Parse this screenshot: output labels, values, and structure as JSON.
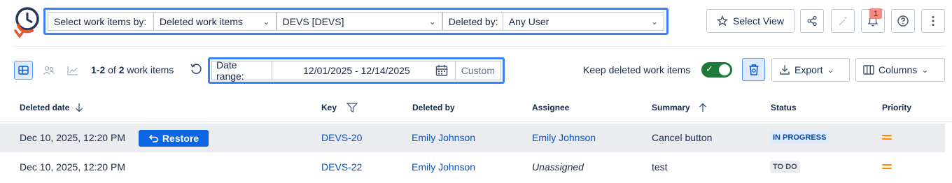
{
  "toolbar": {
    "select_by_label": "Select work items by:",
    "select_by_value": "Deleted work items",
    "project_value": "DEVS [DEVS]",
    "deleted_by_label": "Deleted by:",
    "deleted_by_value": "Any User",
    "select_view_label": "Select View",
    "notification_count": "1",
    "icons": [
      "app-logo-icon",
      "star-icon",
      "share-icon",
      "magic-wand-icon",
      "bell-icon",
      "help-icon",
      "more-icon"
    ]
  },
  "subbar": {
    "count_range": "1-2",
    "count_of": "of",
    "count_total": "2",
    "count_suffix": "work items",
    "date_range_label": "Date range:",
    "date_range_value": "12/01/2025 - 12/14/2025",
    "date_range_mode": "Custom",
    "keep_deleted_label": "Keep deleted work items",
    "keep_deleted_on": true,
    "export_label": "Export",
    "columns_label": "Columns"
  },
  "table": {
    "columns": {
      "deleted_date": "Deleted date",
      "key": "Key",
      "deleted_by": "Deleted by",
      "assignee": "Assignee",
      "summary": "Summary",
      "status": "Status",
      "priority": "Priority"
    },
    "restore_label": "Restore",
    "rows": [
      {
        "deleted_date": "Dec 10, 2025, 12:20 PM",
        "key": "DEVS-20",
        "deleted_by": "Emily Johnson",
        "assignee": "Emily Johnson",
        "summary": "Cancel button",
        "status": "IN PROGRESS",
        "priority": "medium"
      },
      {
        "deleted_date": "Dec 10, 2025, 12:20 PM",
        "key": "DEVS-22",
        "deleted_by": "Emily Johnson",
        "assignee": "Unassigned",
        "summary": "test",
        "status": "TO DO",
        "priority": "medium"
      }
    ]
  },
  "colors": {
    "accent": "#3b82f6",
    "link": "#0052cc",
    "restore_button": "#0c66e4",
    "toggle_on": "#1e7a3a",
    "priority_medium": "#ff8b00",
    "logo_orange": "#e8572b",
    "logo_navy": "#253858"
  }
}
